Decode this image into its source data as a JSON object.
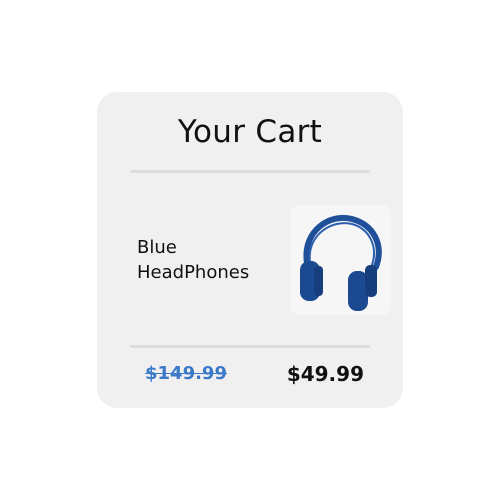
{
  "cart": {
    "title": "Your Cart",
    "item": {
      "name_line1": "Blue",
      "name_line2": "HeadPhones",
      "image_icon": "headphones-icon",
      "image_color": "#1f4f99"
    },
    "original_price": "$149.99",
    "sale_price": "$49.99",
    "colors": {
      "card_background": "#f0f0f1",
      "original_price": "#3a78c8",
      "text": "#111111"
    }
  }
}
